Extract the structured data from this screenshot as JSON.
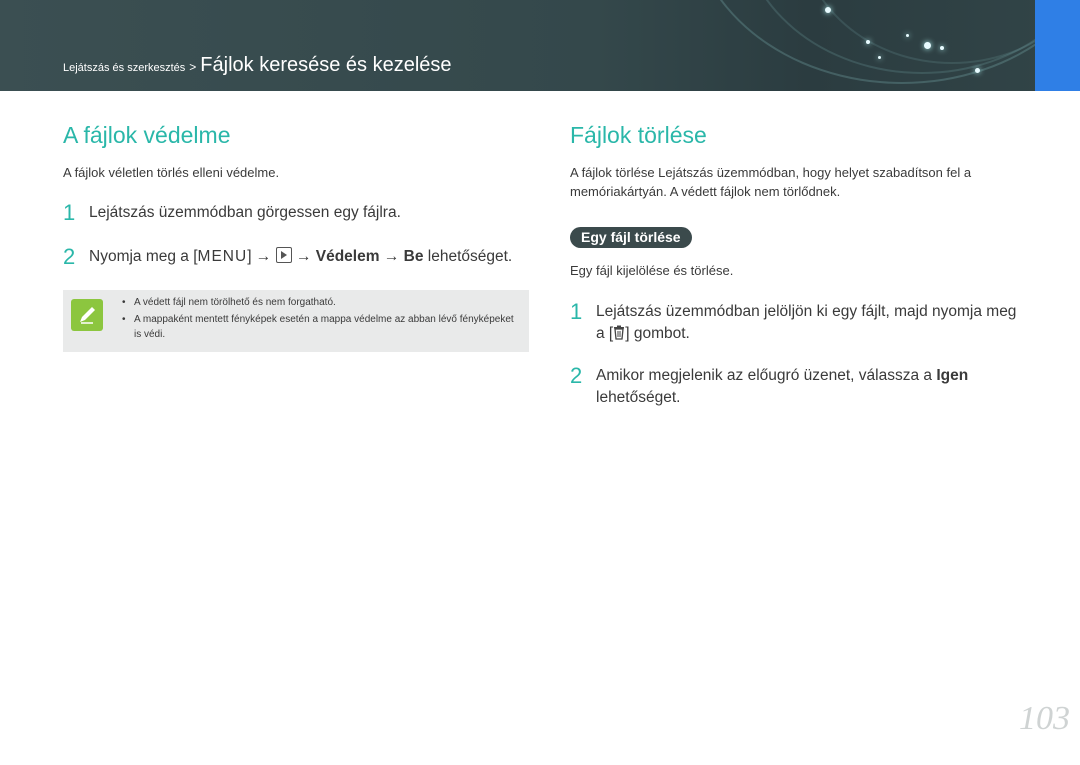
{
  "header": {
    "breadcrumb_small": "Lejátszás és szerkesztés",
    "breadcrumb_sep": ">",
    "breadcrumb_big": "Fájlok keresése és kezelése",
    "accent_color": "#2f7fe6"
  },
  "left": {
    "title": "A fájlok védelme",
    "description": "A fájlok véletlen törlés elleni védelme.",
    "step1_num": "1",
    "step1_text": "Lejátszás üzemmódban görgessen egy fájlra.",
    "step2_num": "2",
    "step2_prefix": "Nyomja meg a [",
    "step2_menu": "MENU",
    "step2_mid": "] →",
    "step2_arrow": "→",
    "step2_bold1": "Védelem",
    "step2_arrow2": "→",
    "step2_bold2": "Be",
    "step2_suffix": "lehetőséget.",
    "note_icon": "pencil-note-icon",
    "notes": [
      "A védett fájl nem törölhető és nem forgatható.",
      "A mappaként mentett fényképek esetén a mappa védelme az abban lévő fényképeket is védi."
    ]
  },
  "right": {
    "title": "Fájlok törlése",
    "description_line1": "A fájlok törlése Lejátszás üzemmódban, hogy helyet szabadítson fel a",
    "description_line2": "memóriakártyán. A védett fájlok nem törlődnek.",
    "subsection_pill": "Egy fájl törlése",
    "subsection_desc": "Egy fájl kijelölése és törlése.",
    "step1_num": "1",
    "step1_line1": "Lejátszás üzemmódban jelöljön ki egy fájlt, majd nyomja meg",
    "step1_line2_prefix": "a [",
    "step1_line2_suffix": "] gombot.",
    "step2_num": "2",
    "step2_prefix": "Amikor megjelenik az előugró üzenet, válassza a",
    "step2_bold": "Igen",
    "step2_line2": "lehetőséget."
  },
  "page_number": "103",
  "colors": {
    "heading": "#2ab7a9",
    "note_icon_bg": "#8cc63f",
    "pill_bg": "#3b4a4c"
  }
}
